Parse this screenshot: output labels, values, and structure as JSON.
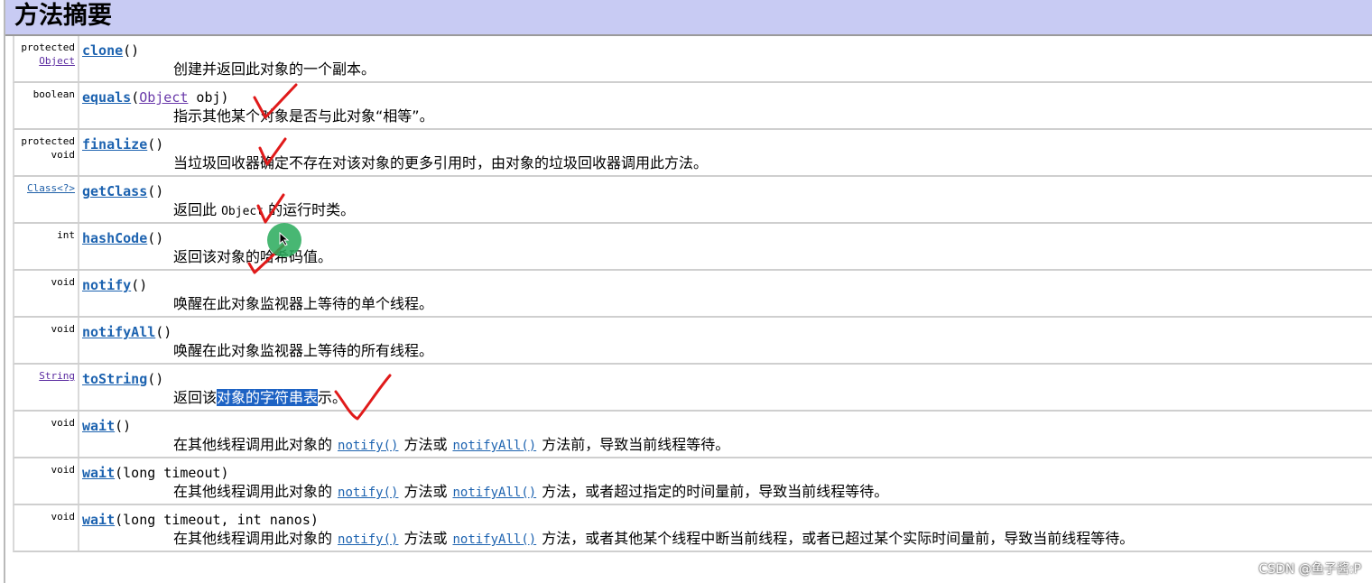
{
  "page": {
    "title": "方法摘要"
  },
  "rows": [
    {
      "modifier": [
        "protected",
        "Object"
      ],
      "modifier_links": [
        false,
        true
      ],
      "method": "clone",
      "params": "()",
      "description": "创建并返回此对象的一个副本。"
    },
    {
      "modifier": [
        "boolean"
      ],
      "method": "equals",
      "params_prefix": "(",
      "param_type": "Object",
      "params_suffix": " obj)",
      "description": "指示其他某个对象是否与此对象“相等”。"
    },
    {
      "modifier": [
        "protected",
        "void"
      ],
      "method": "finalize",
      "params": "()",
      "description": "当垃圾回收器确定不存在对该对象的更多引用时，由对象的垃圾回收器调用此方法。"
    },
    {
      "modifier": [
        "Class<?>"
      ],
      "method": "getClass",
      "params": "()",
      "description_pre": "返回此 ",
      "description_code": "Object",
      "description_post": " 的运行时类。"
    },
    {
      "modifier": [
        "int"
      ],
      "method": "hashCode",
      "params": "()",
      "description": "返回该对象的哈希码值。"
    },
    {
      "modifier": [
        "void"
      ],
      "method": "notify",
      "params": "()",
      "description": "唤醒在此对象监视器上等待的单个线程。"
    },
    {
      "modifier": [
        "void"
      ],
      "method": "notifyAll",
      "params": "()",
      "description": "唤醒在此对象监视器上等待的所有线程。"
    },
    {
      "modifier": [
        "String"
      ],
      "method": "toString",
      "params": "()",
      "description_pre": "返回该",
      "description_highlight": "对象的字符串表",
      "description_post": "示。"
    },
    {
      "modifier": [
        "void"
      ],
      "method": "wait",
      "params": "()",
      "description_pre": "在其他线程调用此对象的",
      "link1": "notify()",
      "description_mid": "方法或",
      "link2": "notifyAll()",
      "description_post": "方法前，导致当前线程等待。"
    },
    {
      "modifier": [
        "void"
      ],
      "method": "wait",
      "params": "(long timeout)",
      "description_pre": "在其他线程调用此对象的",
      "link1": "notify()",
      "description_mid": "方法或",
      "link2": "notifyAll()",
      "description_post": "方法，或者超过指定的时间量前，导致当前线程等待。"
    },
    {
      "modifier": [
        "void"
      ],
      "method": "wait",
      "params": "(long timeout, int nanos)",
      "description_pre": "在其他线程调用此对象的",
      "link1": "notify()",
      "description_mid": "方法或",
      "link2": "notifyAll()",
      "description_post": "方法，或者其他某个线程中断当前线程，或者已超过某个实际时间量前，导致当前线程等待。"
    }
  ],
  "watermark": "CSDN @鱼子酱:P",
  "colors": {
    "header_bg": "#c8cbf3",
    "method_link": "#1d63b0",
    "highlight": "#1e63c4",
    "checkmark": "#e01a1a",
    "cursor": "#28aa5a"
  }
}
